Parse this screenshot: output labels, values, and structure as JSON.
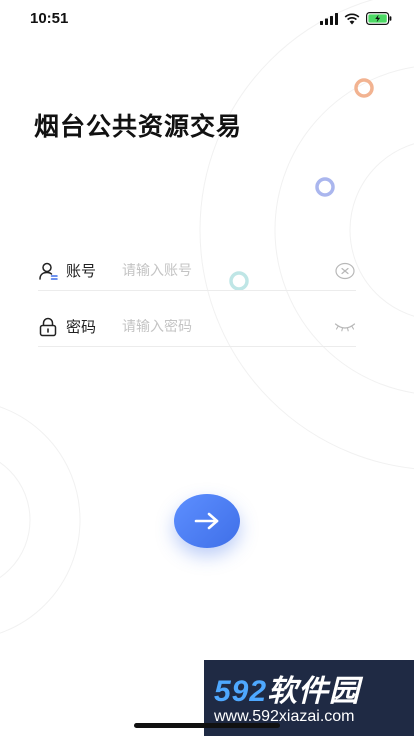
{
  "status_bar": {
    "time": "10:51"
  },
  "title": "烟台公共资源交易",
  "account": {
    "label": "账号",
    "placeholder": "请输入账号",
    "value": ""
  },
  "password": {
    "label": "密码",
    "placeholder": "请输入密码",
    "value": ""
  },
  "icons": {
    "account": "user-icon",
    "password": "lock-icon",
    "clear": "clear-icon",
    "visibility": "eye-closed-icon",
    "submit": "arrow-right-icon"
  },
  "colors": {
    "accent": "#4a7cf2",
    "ring_orange": "#f2b391",
    "ring_blue": "#aab6ee",
    "ring_teal": "#bfe6e6"
  },
  "watermark": {
    "num": "592",
    "cn": "软件园",
    "url": "www.592xiazai.com"
  }
}
